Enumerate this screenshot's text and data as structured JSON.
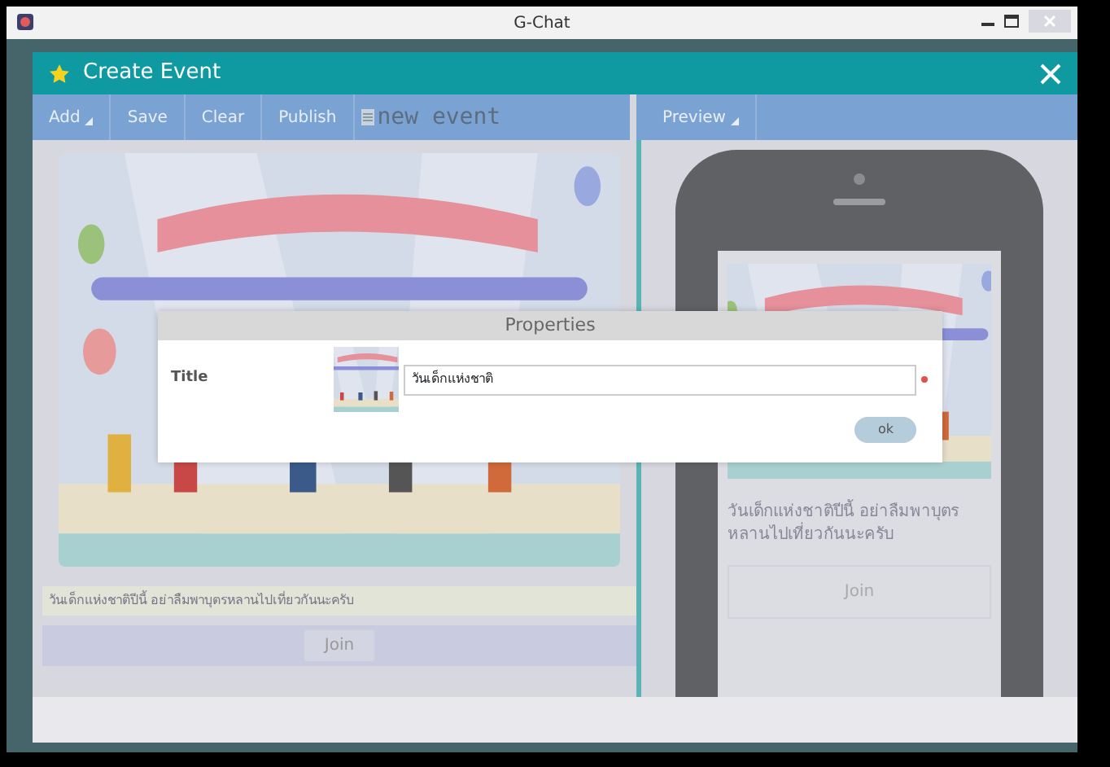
{
  "window": {
    "title": "G-Chat"
  },
  "dialog": {
    "title": "Create Event"
  },
  "toolbar": {
    "items": [
      {
        "label": "Add",
        "kind": "menu"
      },
      {
        "label": "Save",
        "kind": "button"
      },
      {
        "label": "Clear",
        "kind": "button"
      },
      {
        "label": "Publish",
        "kind": "button"
      }
    ],
    "document_name": "new event"
  },
  "preview_toolbar": {
    "items": [
      {
        "label": "Preview",
        "kind": "menu"
      }
    ]
  },
  "editor": {
    "caption": "วันเด็กแห่งชาติปีนี้ อย่าลืมพาบุตรหลานไปเที่ยวกันนะครับ",
    "join_button": "Join"
  },
  "phone_preview": {
    "caption": "วันเด็กแห่งชาติปีนี้ อย่าลืมพาบุตรหลานไปเที่ยวกันนะครับ",
    "join_button": "Join"
  },
  "properties_dialog": {
    "title": "Properties",
    "field_label": "Title",
    "title_value": "วันเด็กแห่งชาติ",
    "required": true,
    "ok_button": "ok"
  }
}
